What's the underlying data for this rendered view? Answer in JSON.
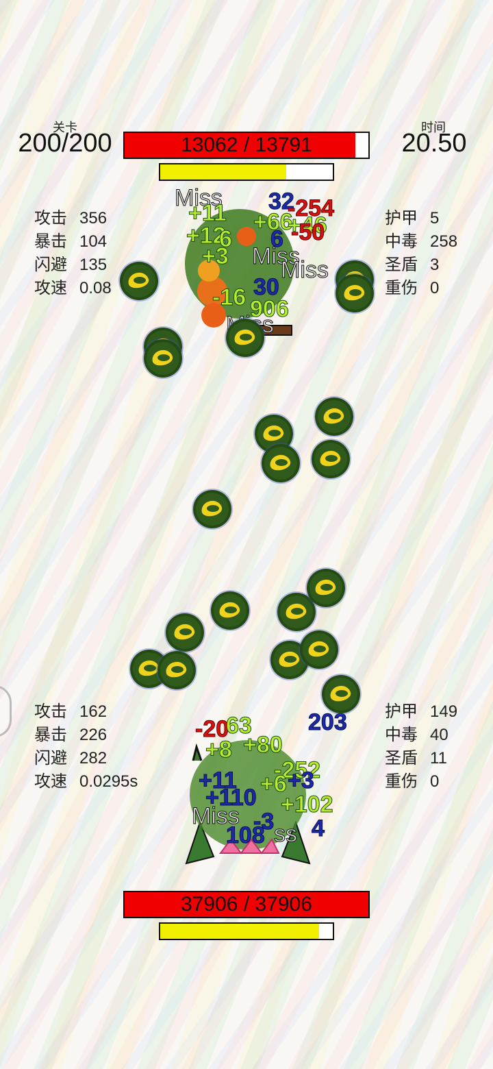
{
  "header": {
    "level_label": "关卡",
    "level_value": "200/200",
    "time_label": "时间",
    "time_value": "20.50"
  },
  "enemy": {
    "hp_text": "13062 / 13791",
    "hp_fraction": 0.947,
    "energy_fraction": 0.73,
    "stats_left": [
      {
        "label": "攻击",
        "value": "356"
      },
      {
        "label": "暴击",
        "value": "104"
      },
      {
        "label": "闪避",
        "value": "135"
      },
      {
        "label": "攻速",
        "value": "0.08"
      }
    ],
    "stats_right": [
      {
        "label": "护甲",
        "value": "5"
      },
      {
        "label": "中毒",
        "value": "258"
      },
      {
        "label": "圣盾",
        "value": "3"
      },
      {
        "label": "重伤",
        "value": "0"
      }
    ],
    "floating_text": [
      "Miss",
      "32",
      "+11",
      "+12",
      "6",
      "6",
      "+66",
      "+46",
      "-254",
      "-50",
      "+3",
      "Miss",
      "Miss",
      "30",
      "-16",
      "906",
      "Miss"
    ]
  },
  "player": {
    "hp_text": "37906 / 37906",
    "hp_fraction": 1.0,
    "energy_fraction": 0.92,
    "stats_left": [
      {
        "label": "攻击",
        "value": "162"
      },
      {
        "label": "暴击",
        "value": "226"
      },
      {
        "label": "闪避",
        "value": "282"
      },
      {
        "label": "攻速",
        "value": "0.0295s"
      }
    ],
    "stats_right": [
      {
        "label": "护甲",
        "value": "149"
      },
      {
        "label": "中毒",
        "value": "40"
      },
      {
        "label": "圣盾",
        "value": "11"
      },
      {
        "label": "重伤",
        "value": "0"
      }
    ],
    "floating_text": [
      "-20",
      "63",
      "203",
      "+80",
      "+8",
      "-252",
      "+11",
      "+6",
      "+3",
      "+110",
      "+102",
      "Miss",
      "-3",
      "4",
      "108",
      "ss"
    ]
  },
  "colors": {
    "hp_fill": "#f00000",
    "energy_fill": "#f0f000"
  }
}
